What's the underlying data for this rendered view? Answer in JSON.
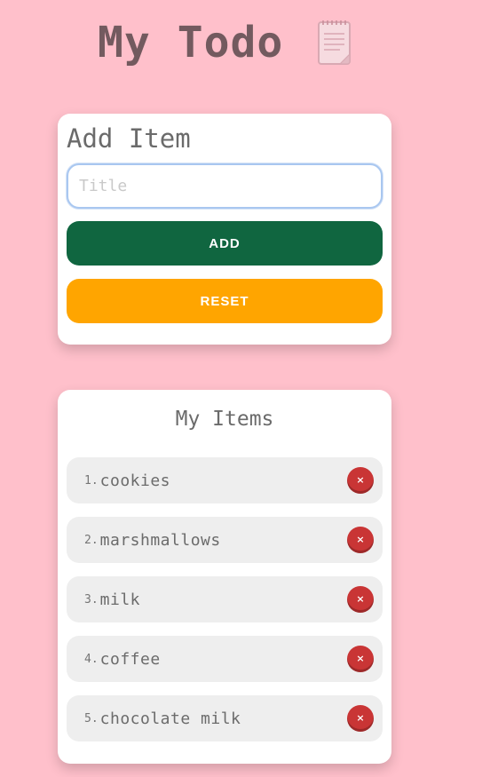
{
  "header": {
    "title": "My Todo",
    "icon": "notepad-icon"
  },
  "add_item": {
    "heading": "Add Item",
    "input_placeholder": "Title",
    "input_value": "",
    "add_label": "ADD",
    "reset_label": "RESET"
  },
  "my_items": {
    "heading": "My Items",
    "items": [
      {
        "number": "1.",
        "text": "cookies",
        "delete_icon": "×"
      },
      {
        "number": "2.",
        "text": "marshmallows",
        "delete_icon": "×"
      },
      {
        "number": "3.",
        "text": "milk",
        "delete_icon": "×"
      },
      {
        "number": "4.",
        "text": "coffee",
        "delete_icon": "×"
      },
      {
        "number": "5.",
        "text": "chocolate milk",
        "delete_icon": "×"
      }
    ]
  },
  "colors": {
    "background": "#ffc0cb",
    "add_button": "#106640",
    "reset_button": "#ffa500",
    "delete_button": "#c93535"
  }
}
